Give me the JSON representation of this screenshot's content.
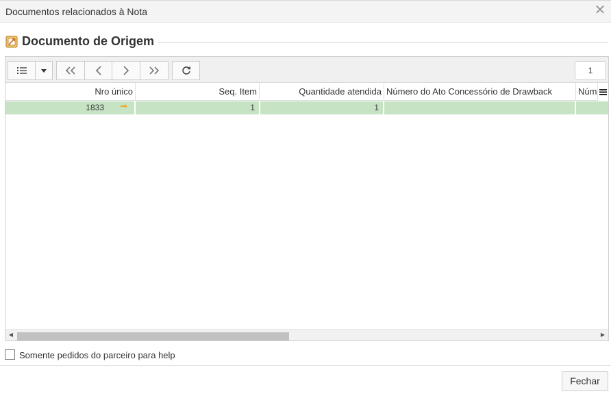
{
  "window": {
    "title": "Documentos relacionados à Nota"
  },
  "section": {
    "title": "Documento de Origem"
  },
  "toolbar": {
    "page_number": "1"
  },
  "table": {
    "columns": [
      "Nro único",
      "Seq. Item",
      "Quantidade atendida",
      "Número do Ato Concessório de Drawback",
      "Núm"
    ],
    "rows": [
      {
        "nro_unico": "1833",
        "seq_item": "1",
        "quantidade_atendida": "1",
        "numero_ato": "",
        "num": ""
      }
    ]
  },
  "filter": {
    "checkbox_label": "Somente pedidos do parceiro para help"
  },
  "footer": {
    "close_label": "Fechar"
  },
  "colors": {
    "row_selected": "#c6e3c3",
    "marker": "#f5a623"
  }
}
